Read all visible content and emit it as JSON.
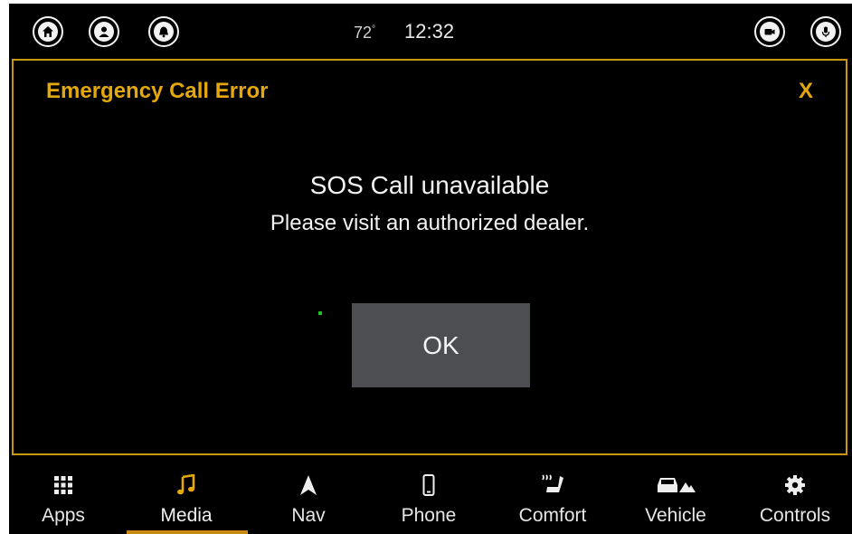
{
  "status_bar": {
    "icons": [
      "home-icon",
      "user-icon",
      "bell-icon",
      "camera-icon",
      "microphone-icon"
    ],
    "temperature": "72",
    "temperature_unit": "°",
    "time": "12:32"
  },
  "dialog": {
    "title": "Emergency Call Error",
    "close_label": "X",
    "message": "SOS Call unavailable",
    "sub_message": "Please visit an authorized dealer.",
    "ok_label": "OK"
  },
  "nav": {
    "items": [
      {
        "label": "Apps",
        "icon": "grid-icon"
      },
      {
        "label": "Media",
        "icon": "music-note-icon"
      },
      {
        "label": "Nav",
        "icon": "navigation-arrow-icon"
      },
      {
        "label": "Phone",
        "icon": "phone-icon"
      },
      {
        "label": "Comfort",
        "icon": "seat-climate-icon"
      },
      {
        "label": "Vehicle",
        "icon": "vehicle-icon"
      },
      {
        "label": "Controls",
        "icon": "gear-icon"
      }
    ],
    "active": "Media"
  },
  "colors": {
    "accent": "#e4a80e",
    "background": "#000000",
    "button": "#4c4e52",
    "text": "#f2f2f2"
  }
}
